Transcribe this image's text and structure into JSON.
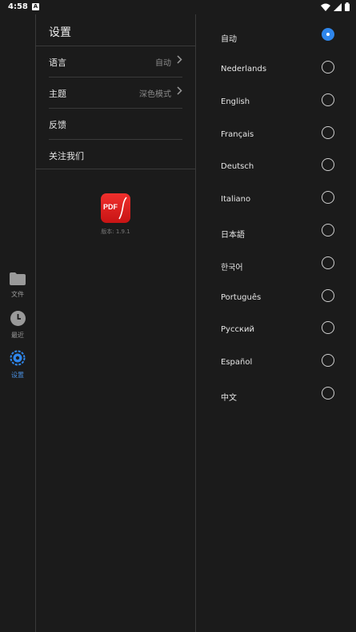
{
  "status_bar": {
    "time": "4:58",
    "notification_badge": "A"
  },
  "rail": {
    "items": [
      {
        "label": "文件",
        "icon": "folder-icon"
      },
      {
        "label": "最近",
        "icon": "clock-icon"
      },
      {
        "label": "设置",
        "icon": "gear-icon",
        "active": true
      }
    ]
  },
  "settings": {
    "title": "设置",
    "rows": [
      {
        "label": "语言",
        "value": "自动"
      },
      {
        "label": "主题",
        "value": "深色模式"
      },
      {
        "label": "反馈",
        "value": ""
      },
      {
        "label": "关注我们",
        "value": ""
      }
    ],
    "app_logo_text": "PDF",
    "version": "版本: 1.9.1"
  },
  "languages": [
    {
      "name": "自动",
      "selected": true
    },
    {
      "name": "Nederlands",
      "selected": false
    },
    {
      "name": "English",
      "selected": false
    },
    {
      "name": "Français",
      "selected": false
    },
    {
      "name": "Deutsch",
      "selected": false
    },
    {
      "name": "Italiano",
      "selected": false
    },
    {
      "name": "日本語",
      "selected": false
    },
    {
      "name": "한국어",
      "selected": false
    },
    {
      "name": "Português",
      "selected": false
    },
    {
      "name": "Русский",
      "selected": false
    },
    {
      "name": "Español",
      "selected": false
    },
    {
      "name": "中文",
      "selected": false
    }
  ],
  "colors": {
    "accent": "#2f86eb",
    "background": "#1b1b1b",
    "divider": "#3a3a3a"
  }
}
